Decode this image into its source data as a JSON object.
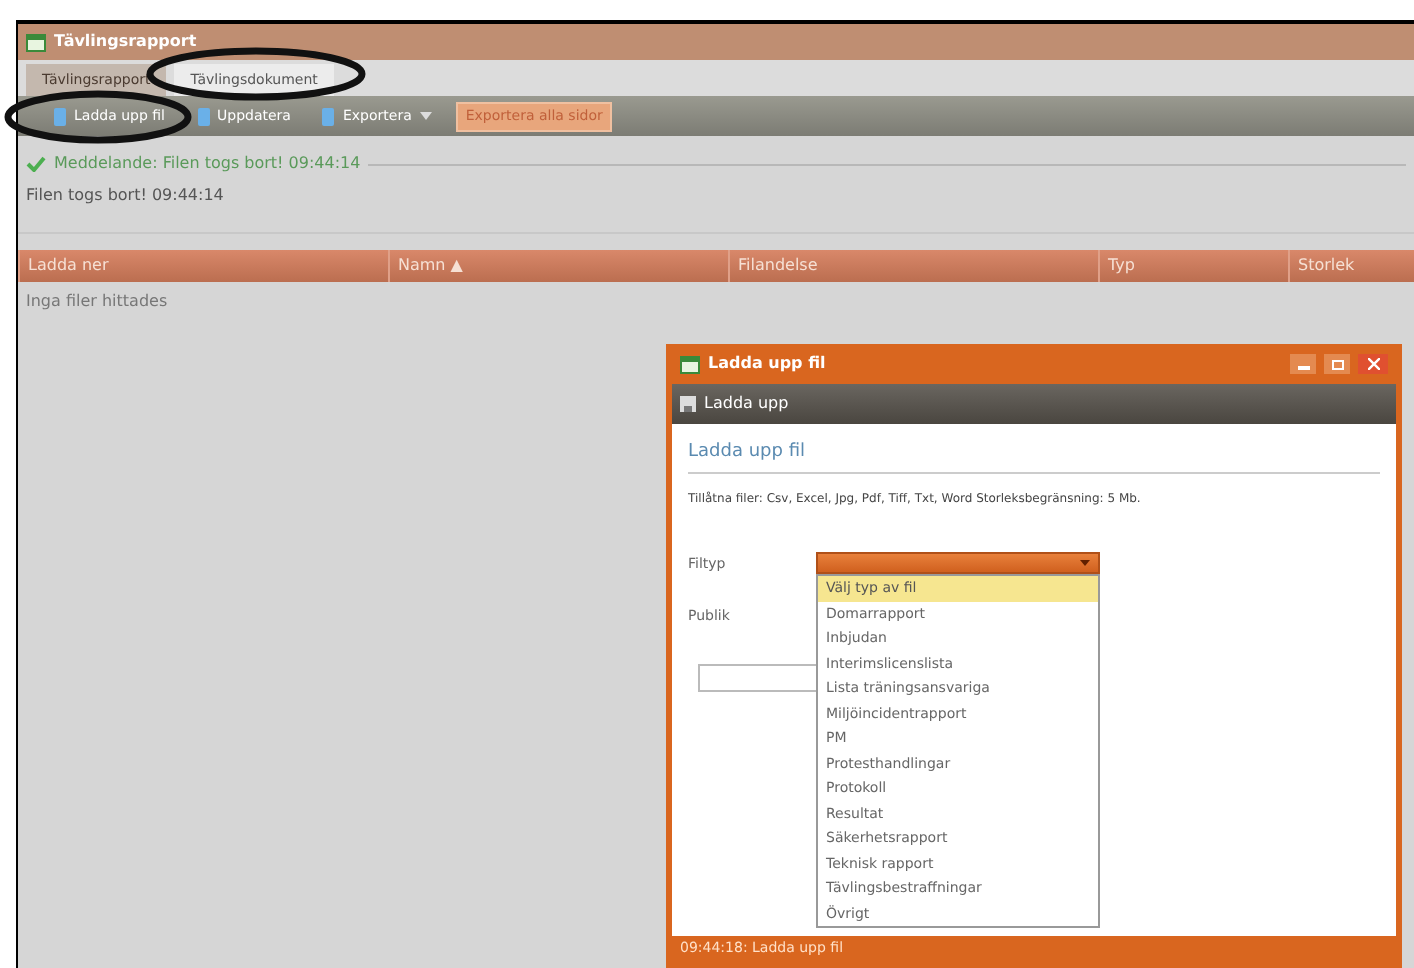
{
  "window": {
    "title": "Tävlingsrapport"
  },
  "tabs": [
    {
      "label": "Tävlingsrapport",
      "selected": false
    },
    {
      "label": "Tävlingsdokument",
      "selected": true
    }
  ],
  "toolbar": [
    {
      "kind": "icon",
      "label": "Ladda upp fil"
    },
    {
      "kind": "icon",
      "label": "Uppdatera"
    },
    {
      "kind": "menu",
      "label": "Exportera"
    },
    {
      "kind": "accent",
      "label": "Exportera alla sidor"
    }
  ],
  "message": {
    "title": "Meddelande: Filen togs bort! 09:44:14",
    "text": "Filen togs bort! 09:44:14"
  },
  "table": {
    "columns": [
      {
        "label": "Ladda ner"
      },
      {
        "label": "Namn ▲"
      },
      {
        "label": "Filandelse"
      },
      {
        "label": "Typ"
      },
      {
        "label": "Storlek"
      }
    ],
    "empty_text": "Inga filer hittades"
  },
  "dialog": {
    "title": "Ladda upp fil",
    "toolbar_button": "Ladda upp",
    "heading": "Ladda upp fil",
    "info": "Tillåtna filer: Csv, Excel, Jpg, Pdf, Tiff, Txt, Word Storleksbegränsning: 5 Mb.",
    "fields": [
      {
        "label": "Filtyp"
      },
      {
        "label": "Publik"
      }
    ],
    "options": [
      {
        "label": "Välj typ av fil",
        "selected": true
      },
      {
        "label": "Domarrapport",
        "selected": false
      },
      {
        "label": "Inbjudan",
        "selected": false
      },
      {
        "label": "Interimslicenslista",
        "selected": false
      },
      {
        "label": "Lista träningsansvariga",
        "selected": false
      },
      {
        "label": "Miljöincidentrapport",
        "selected": false
      },
      {
        "label": "PM",
        "selected": false
      },
      {
        "label": "Protesthandlingar",
        "selected": false
      },
      {
        "label": "Protokoll",
        "selected": false
      },
      {
        "label": "Resultat",
        "selected": false
      },
      {
        "label": "Säkerhetsrapport",
        "selected": false
      },
      {
        "label": "Teknisk rapport",
        "selected": false
      },
      {
        "label": "Tävlingsbestraffningar",
        "selected": false
      },
      {
        "label": "Övrigt",
        "selected": false
      }
    ],
    "status": "09:44:18: Ladda upp fil"
  }
}
